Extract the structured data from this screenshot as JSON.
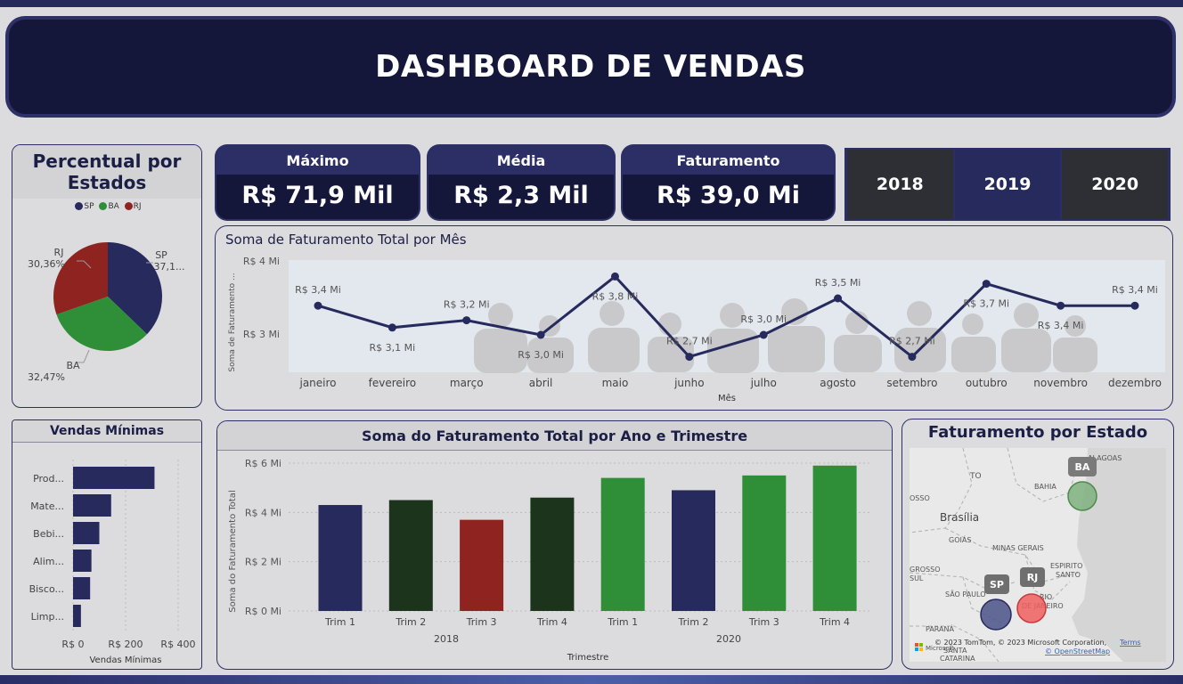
{
  "header": {
    "title": "DASHBOARD DE VENDAS"
  },
  "kpis": [
    {
      "label": "Máximo",
      "value": "R$ 71,9 Mil"
    },
    {
      "label": "Média",
      "value": "R$ 2,3 Mil"
    },
    {
      "label": "Faturamento",
      "value": "R$ 39,0 Mi"
    }
  ],
  "year_slicer": {
    "options": [
      "2018",
      "2019",
      "2020"
    ]
  },
  "pie": {
    "title": "Percentual por Estados",
    "legend": [
      {
        "label": "SP",
        "color": "#262a5c"
      },
      {
        "label": "BA",
        "color": "#2f8f38"
      },
      {
        "label": "RJ",
        "color": "#8e2320"
      }
    ],
    "labels": {
      "sp_name": "SP",
      "sp_value": "37,1...",
      "rj_name": "RJ",
      "rj_value": "30,36%",
      "ba_name": "BA",
      "ba_value": "32,47%"
    }
  },
  "line_panel": {
    "title": "Soma de Faturamento Total por Mês",
    "y_label": "Soma de Faturamento ...",
    "x_label": "Mês",
    "y_ticks": [
      "R$ 4 Mi",
      "R$ 3 Mi"
    ]
  },
  "hbar_panel": {
    "title": "Vendas Mínimas",
    "x_label": "Vendas Mínimas",
    "x_ticks": [
      "R$ 0",
      "R$ 200",
      "R$ 400"
    ]
  },
  "col_panel": {
    "title": "Soma do Faturamento Total por Ano e Trimestre",
    "y_label": "Soma do Faturamento Total",
    "x_label": "Trimestre",
    "y_ticks": [
      "R$ 0 Mi",
      "R$ 2 Mi",
      "R$ 4 Mi",
      "R$ 6 Mi"
    ],
    "year_labels": [
      "2018",
      "2020"
    ]
  },
  "map_panel": {
    "title": "Faturamento por Estado",
    "labels": {
      "to": "TO",
      "bahia": "BAHIA",
      "alagoas": "ALAGOAS",
      "brasilia": "Brasília",
      "goias": "GOIÁS",
      "minas": "MINAS GERAIS",
      "espirito": "ESPIRITO",
      "santo": "SANTO",
      "sao_paulo": "SÃO PAULO",
      "janeiro": "DE JANEIRO",
      "rio": "RIO",
      "parana": "PARANÁ",
      "grosso1": "OSSO",
      "grosso2": "GROSSO",
      "sul": "SUL",
      "santa": "SANTA",
      "catarina": "CATARINA",
      "ba_badge": "BA",
      "sp_badge": "SP",
      "rj_badge": "RJ"
    },
    "attribution": "© 2023 TomTom, © 2023 Microsoft Corporation,",
    "terms": "Terms",
    "osm": "© OpenStreetMap",
    "ms_logo": "Microsoft"
  },
  "chart_data": [
    {
      "type": "pie",
      "title": "Percentual por Estados",
      "categories": [
        "SP",
        "BA",
        "RJ"
      ],
      "values": [
        37.17,
        32.47,
        30.36
      ],
      "legend": "top"
    },
    {
      "type": "line",
      "title": "Soma de Faturamento Total por Mês",
      "xlabel": "Mês",
      "ylabel": "Soma de Faturamento ...",
      "categories": [
        "janeiro",
        "fevereiro",
        "março",
        "abril",
        "maio",
        "junho",
        "julho",
        "agosto",
        "setembro",
        "outubro",
        "novembro",
        "dezembro"
      ],
      "values": [
        3.4,
        3.1,
        3.2,
        3.0,
        3.8,
        2.7,
        3.0,
        3.5,
        2.7,
        3.7,
        3.4,
        3.4
      ],
      "data_labels": [
        "R$ 3,4 Mi",
        "R$ 3,1 Mi",
        "R$ 3,2 Mi",
        "R$ 3,0 Mi",
        "R$ 3,8 Mi",
        "R$ 2,7 Mi",
        "R$ 3,0 Mi",
        "R$ 3,5 Mi",
        "R$ 2,7 Mi",
        "R$ 3,7 Mi",
        "R$ 3,4 Mi",
        "R$ 3,4 Mi"
      ],
      "ylim": [
        2.5,
        4.0
      ],
      "grid": false
    },
    {
      "type": "bar",
      "orientation": "horizontal",
      "title": "Vendas Mínimas",
      "xlabel": "Vendas Mínimas",
      "categories": [
        "Prod...",
        "Mate...",
        "Bebi...",
        "Alim...",
        "Bisco...",
        "Limp..."
      ],
      "values": [
        310,
        145,
        100,
        70,
        65,
        30
      ],
      "xlim": [
        0,
        400
      ],
      "color": "#262a5c"
    },
    {
      "type": "bar",
      "title": "Soma do Faturamento Total por Ano e Trimestre",
      "xlabel": "Trimestre",
      "ylabel": "Soma do Faturamento Total",
      "categories": [
        "Trim 1",
        "Trim 2",
        "Trim 3",
        "Trim 4",
        "Trim 1",
        "Trim 2",
        "Trim 3",
        "Trim 4"
      ],
      "groups": [
        "2018",
        "2018",
        "2018",
        "2018",
        "2020",
        "2020",
        "2020",
        "2020"
      ],
      "values": [
        4.3,
        4.5,
        3.7,
        4.6,
        5.4,
        4.9,
        5.5,
        5.9
      ],
      "colors": [
        "#262a5c",
        "#1c341c",
        "#8e2320",
        "#1c341c",
        "#2f8f38",
        "#262a5c",
        "#2f8f38",
        "#2f8f38"
      ],
      "ylim": [
        0,
        6
      ]
    }
  ]
}
